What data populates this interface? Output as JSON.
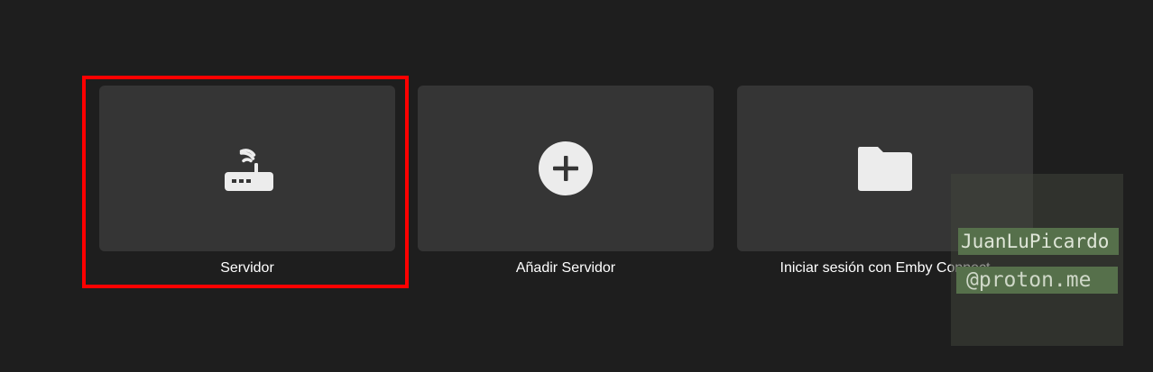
{
  "cards": [
    {
      "label": "Servidor",
      "icon": "router-icon"
    },
    {
      "label": "Añadir Servidor",
      "icon": "add-circle-icon"
    },
    {
      "label": "Iniciar sesión con Emby Connect",
      "icon": "folder-icon"
    }
  ],
  "watermark": {
    "line1": "JuanLuPicardo",
    "line2": "@proton.me"
  },
  "colors": {
    "background": "#1e1e1e",
    "tile": "#353535",
    "highlight": "#ff0000",
    "icon": "#ececec"
  }
}
